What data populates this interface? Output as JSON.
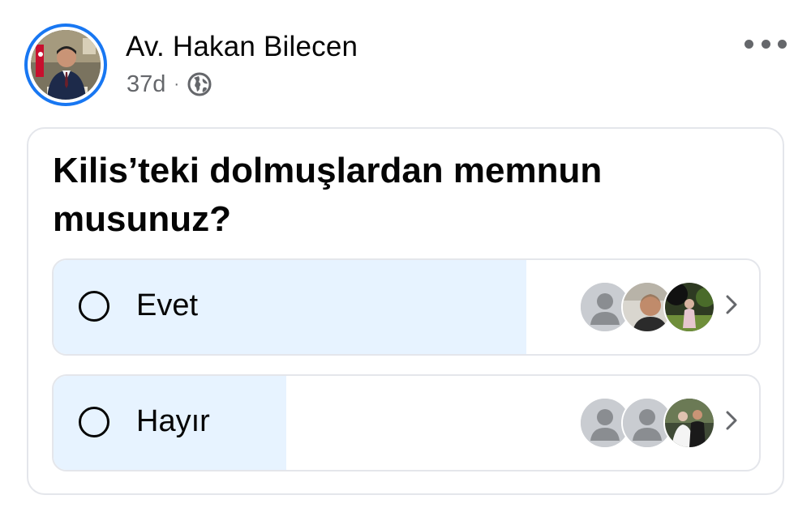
{
  "post": {
    "author": "Av. Hakan Bilecen",
    "time": "37d",
    "separator": "·",
    "privacy_icon": "globe-icon",
    "more_icon": "more-options-icon"
  },
  "poll": {
    "question": "Kilis’teki dolmuşlardan memnun musunuz?",
    "options": [
      {
        "label": "Evet",
        "vote_fraction": 0.67,
        "voters": [
          "default-avatar",
          "photo-avatar",
          "photo-avatar"
        ]
      },
      {
        "label": "Hayır",
        "vote_fraction": 0.33,
        "voters": [
          "default-avatar",
          "default-avatar",
          "photo-avatar"
        ]
      }
    ]
  },
  "colors": {
    "accent": "#1877f2",
    "poll_fill": "#e7f3ff",
    "border": "#e4e6eb",
    "secondary_text": "#65676b"
  }
}
